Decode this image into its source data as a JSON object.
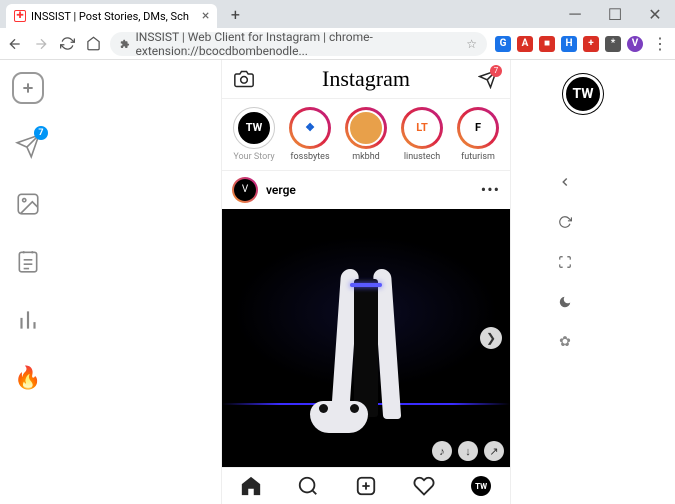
{
  "browser": {
    "tab_title": "INSSIST | Post Stories, DMs, Sch",
    "url_text": "INSSIST | Web Client for Instagram |  chrome-extension://bcocdbombenodle...",
    "ext_icons": [
      "G",
      "A",
      "■",
      "H",
      "+",
      "*",
      "V"
    ],
    "ext_colors": [
      "#1a73e8",
      "#d93025",
      "#d93025",
      "#1a73e8",
      "#d93025",
      "#555",
      "#7b3fbf"
    ]
  },
  "leftrail": {
    "send_badge": "7"
  },
  "instagram": {
    "logo": "Instagram",
    "dm_badge": "7",
    "stories": [
      {
        "label": "Your Story",
        "initials": "TW",
        "bg": "#000",
        "fg": "#fff",
        "active": false,
        "own": true
      },
      {
        "label": "fossbytes",
        "initials": "❖",
        "bg": "#fff",
        "fg": "#1560d4",
        "active": true,
        "own": false
      },
      {
        "label": "mkbhd",
        "initials": "",
        "bg": "#e8a04a",
        "fg": "#000",
        "active": true,
        "own": false
      },
      {
        "label": "linustech",
        "initials": "LT",
        "bg": "#fff",
        "fg": "#f26522",
        "active": true,
        "own": false
      },
      {
        "label": "futurism",
        "initials": "F",
        "bg": "#fff",
        "fg": "#000",
        "active": true,
        "own": false
      }
    ],
    "post": {
      "username": "verge",
      "avatar_text": "V"
    },
    "profile_initials": "TW"
  },
  "right": {
    "badge": "TW"
  }
}
